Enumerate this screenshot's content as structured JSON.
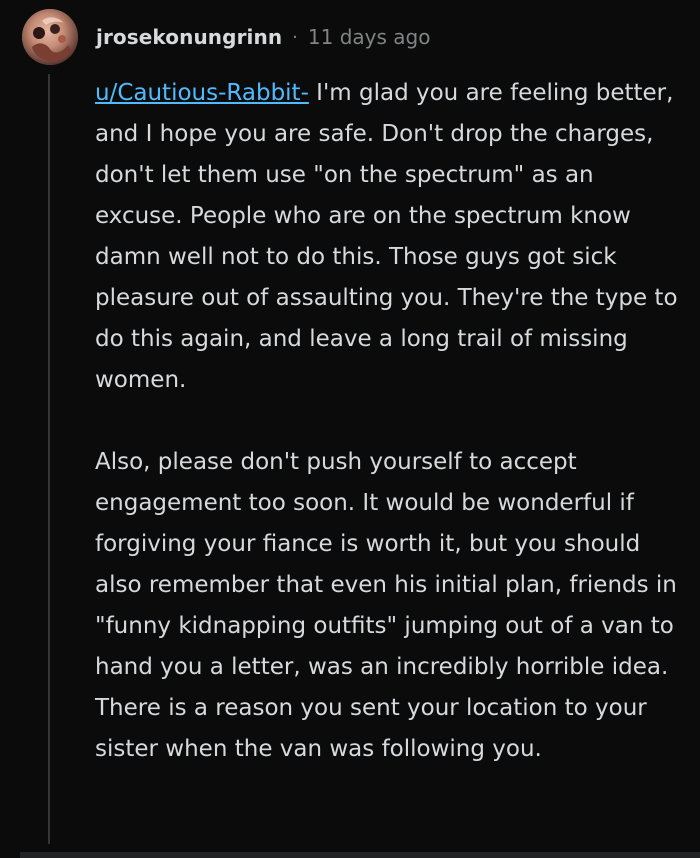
{
  "comment": {
    "author": "jrosekonungrinn",
    "separator": "·",
    "timestamp": "11 days ago",
    "mention": "u/Cautious-Rabbit-",
    "paragraph1_after_mention": " I'm glad you are feeling better, and I hope you are safe. Don't drop the charges, don't let them use \"on the spectrum\" as an excuse. People who are on the spectrum know damn well not to do this. Those guys got sick pleasure out of assaulting you. They're the type to do this again, and leave a long trail of missing women.",
    "paragraph2": "Also, please don't push yourself to accept engagement too soon. It would be wonderful if forgiving your fiance is worth it, but you should also remember that even his initial plan, friends in \"funny kidnapping outfits\" jumping out of a van to hand you a letter, was an incredibly horrible idea. There is a reason you sent your location to your sister when the van was following you."
  },
  "colors": {
    "background": "#0b0b0b",
    "text": "#d7dadc",
    "muted": "#818384",
    "link": "#4fbcff",
    "thread_line": "#343536"
  },
  "icons": {
    "avatar": "user-avatar"
  }
}
